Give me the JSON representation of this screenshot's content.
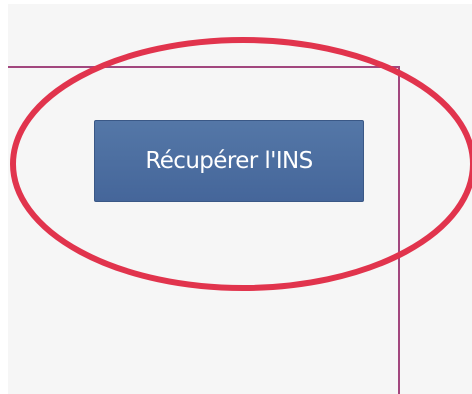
{
  "panel": {
    "background": "#f6f6f6",
    "frame_color": "#a2477e"
  },
  "action": {
    "button_label": "Récupérer l'INS",
    "button_color": "#4d6fa2"
  },
  "annotation": {
    "shape": "ellipse",
    "color": "#e1344d"
  }
}
